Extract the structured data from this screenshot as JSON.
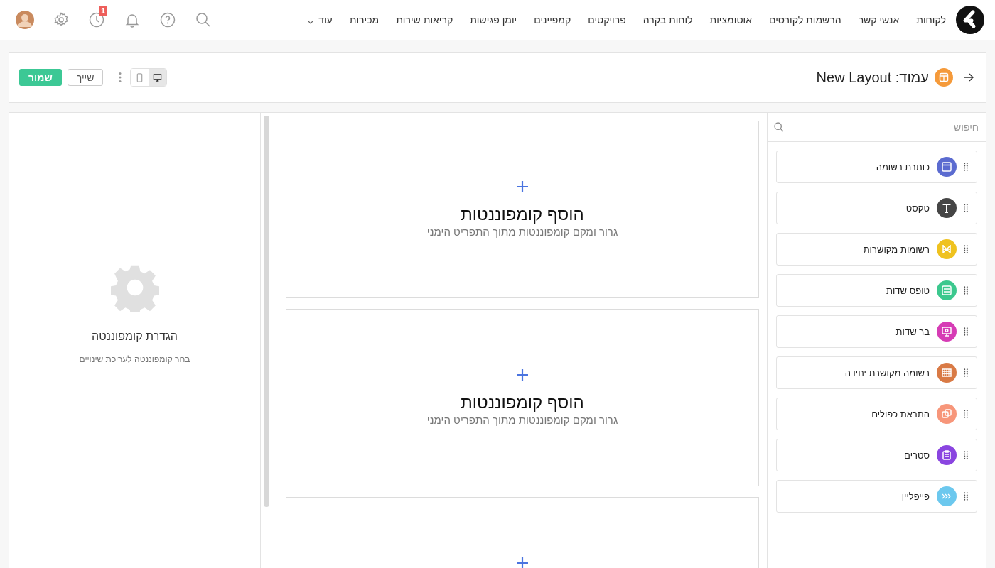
{
  "nav": {
    "items": [
      "לקוחות",
      "אנשי קשר",
      "הרשמות לקורסים",
      "אוטומציות",
      "לוחות בקרה",
      "פרויקטים",
      "קמפיינים",
      "יומן פגישות",
      "קריאות שירות",
      "מכירות"
    ],
    "more": "עוד"
  },
  "notifications": {
    "badge": "1"
  },
  "page_bar": {
    "title": "עמוד: New Layout",
    "devices": [
      {
        "kind": "desktop",
        "selected": true
      },
      {
        "kind": "mobile",
        "selected": false
      }
    ],
    "share_button": "שייך",
    "save_button": "שמור"
  },
  "components_panel": {
    "search": {
      "placeholder": "חיפוש"
    },
    "items": [
      {
        "label": "כותרת רשומה",
        "kind": "header",
        "color": "#5b6bd0"
      },
      {
        "label": "טקסט",
        "kind": "text",
        "color": "#454545"
      },
      {
        "label": "רשומות מקושרות",
        "kind": "linked",
        "color": "#efc21f"
      },
      {
        "label": "טופס שדות",
        "kind": "form",
        "color": "#3cc88e"
      },
      {
        "label": "בר שדות",
        "kind": "bar",
        "color": "#d63cb5"
      },
      {
        "label": "רשומה מקושרת יחידה",
        "kind": "grid",
        "color": "#d97a45"
      },
      {
        "label": "התראת כפולים",
        "kind": "duplicates",
        "color": "#f7967a"
      },
      {
        "label": "סטרים",
        "kind": "clipboard",
        "color": "#8a45e0"
      },
      {
        "label": "פייפליין",
        "kind": "pipeline",
        "color": "#6cc8ee"
      }
    ]
  },
  "canvas": {
    "dropzones": [
      {
        "title": "הוסף קומפוננטות",
        "subtitle": "גרור ומקם קומפוננטות מתוך התפריט הימני"
      },
      {
        "title": "הוסף קומפוננטות",
        "subtitle": "גרור ומקם קומפוננטות מתוך התפריט הימני"
      }
    ]
  },
  "settings_panel": {
    "title": "הגדרת קומפוננטה",
    "subtitle": "בחר קומפוננטה לעריכת שינויים"
  }
}
